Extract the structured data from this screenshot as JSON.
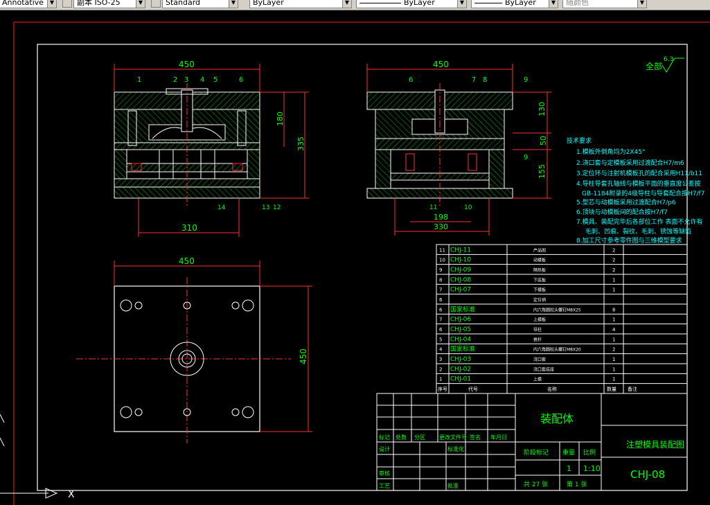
{
  "toolbar": {
    "text_style": "Annotative",
    "dim_style": "副本 ISO-25",
    "table_style": "Standard",
    "layer": "ByLayer",
    "linetype": "ByLayer",
    "lineweight": "ByLayer",
    "plot_style": "随颜色"
  },
  "drawing": {
    "dims": {
      "front_width": "450",
      "front_bottom": "310",
      "front_h1": "180",
      "front_h2": "335",
      "side_width": "450",
      "side_h1": "130",
      "side_h2": "50",
      "side_h3": "155",
      "side_b1": "198",
      "side_b2": "330",
      "top_width": "450",
      "top_height": "450"
    },
    "balloons_front": [
      "1",
      "2",
      "3",
      "4",
      "5",
      "6",
      "14",
      "13",
      "12"
    ],
    "balloons_side": [
      "6",
      "7",
      "8",
      "9",
      "9",
      "11",
      "10"
    ],
    "roughness_label": "全部",
    "roughness_value": "6.3"
  },
  "tech_req": {
    "title": "技术要求",
    "items": [
      "1.模板外倒角均为2X45°",
      "2.浇口套与定模板采用过渡配合H7/m6",
      "3.定位环与注射机模板孔的配合采用H11/b11",
      "4.导柱导套孔轴线与模板平面的垂直度公差按",
      "GB-1184附录的4级导柱与导套配合按H7/f7",
      "5.型芯与动模板采用过渡配合H7/p6",
      "6.顶块与动模板间的配合按H7/f7",
      "7.模具、装配完毕后各部位工作 表面不允许有",
      "毛刺、凹痕、裂纹、毛刺、锈蚀等缺陷",
      "8.加工尺寸参考零件图与三维模型要求"
    ]
  },
  "bom": {
    "rows": [
      {
        "no": "11",
        "code": "CHJ-11",
        "name": "产品图",
        "qty": "2"
      },
      {
        "no": "10",
        "code": "CHJ-10",
        "name": "动模板",
        "qty": "2"
      },
      {
        "no": "9",
        "code": "CHJ-09",
        "name": "隔热板",
        "qty": "2"
      },
      {
        "no": "8",
        "code": "CHJ-08",
        "name": "下底板",
        "qty": "1"
      },
      {
        "no": "7",
        "code": "CHJ-07",
        "name": "下模板",
        "qty": "1"
      },
      {
        "no": "6",
        "code": "",
        "name": "定位销",
        "qty": ""
      },
      {
        "no": "6",
        "code": "国家标准",
        "name": "内六角圆柱头螺钉M8X25",
        "qty": "8"
      },
      {
        "no": "7",
        "code": "CHJ-06",
        "name": "上模板",
        "qty": "1"
      },
      {
        "no": "6",
        "code": "CHJ-05",
        "name": "导柱",
        "qty": "4"
      },
      {
        "no": "5",
        "code": "CHJ-04",
        "name": "推杆",
        "qty": "1"
      },
      {
        "no": "4",
        "code": "国家标准",
        "name": "内六角圆柱头螺钉M8X20",
        "qty": "2"
      },
      {
        "no": "3",
        "code": "CHJ-03",
        "name": "浇口套",
        "qty": "1"
      },
      {
        "no": "2",
        "code": "CHJ-02",
        "name": "浇口套底座",
        "qty": "1"
      },
      {
        "no": "1",
        "code": "CHJ-01",
        "name": "上模",
        "qty": "1"
      }
    ],
    "header": {
      "no": "序号",
      "code": "代号",
      "name": "名称",
      "qty": "数量",
      "note": "备注"
    }
  },
  "title_block": {
    "part_name": "装配体",
    "drawing_title": "注塑模具装配图",
    "drawing_no": "CHJ-08",
    "stage_label": "阶段标记",
    "weight_label": "重量",
    "scale_label": "比例",
    "weight": "1",
    "scale": "1:10",
    "sheets_total": "共 27 张",
    "sheet_no": "第 1 张",
    "rev_headers": [
      "标记",
      "处数",
      "分区",
      "更改文件号",
      "签名",
      "年月日"
    ],
    "roles": [
      "设计",
      "审核",
      "工艺"
    ],
    "roles2": [
      "标准化",
      "批准"
    ]
  },
  "colors": {
    "background": "#000000",
    "line": "#ffffff",
    "dimension": "#ff0000",
    "hatch": "#00cc00",
    "text_green": "#00ff00",
    "text_cyan": "#00ffff",
    "bolt_red": "#ff3030"
  }
}
